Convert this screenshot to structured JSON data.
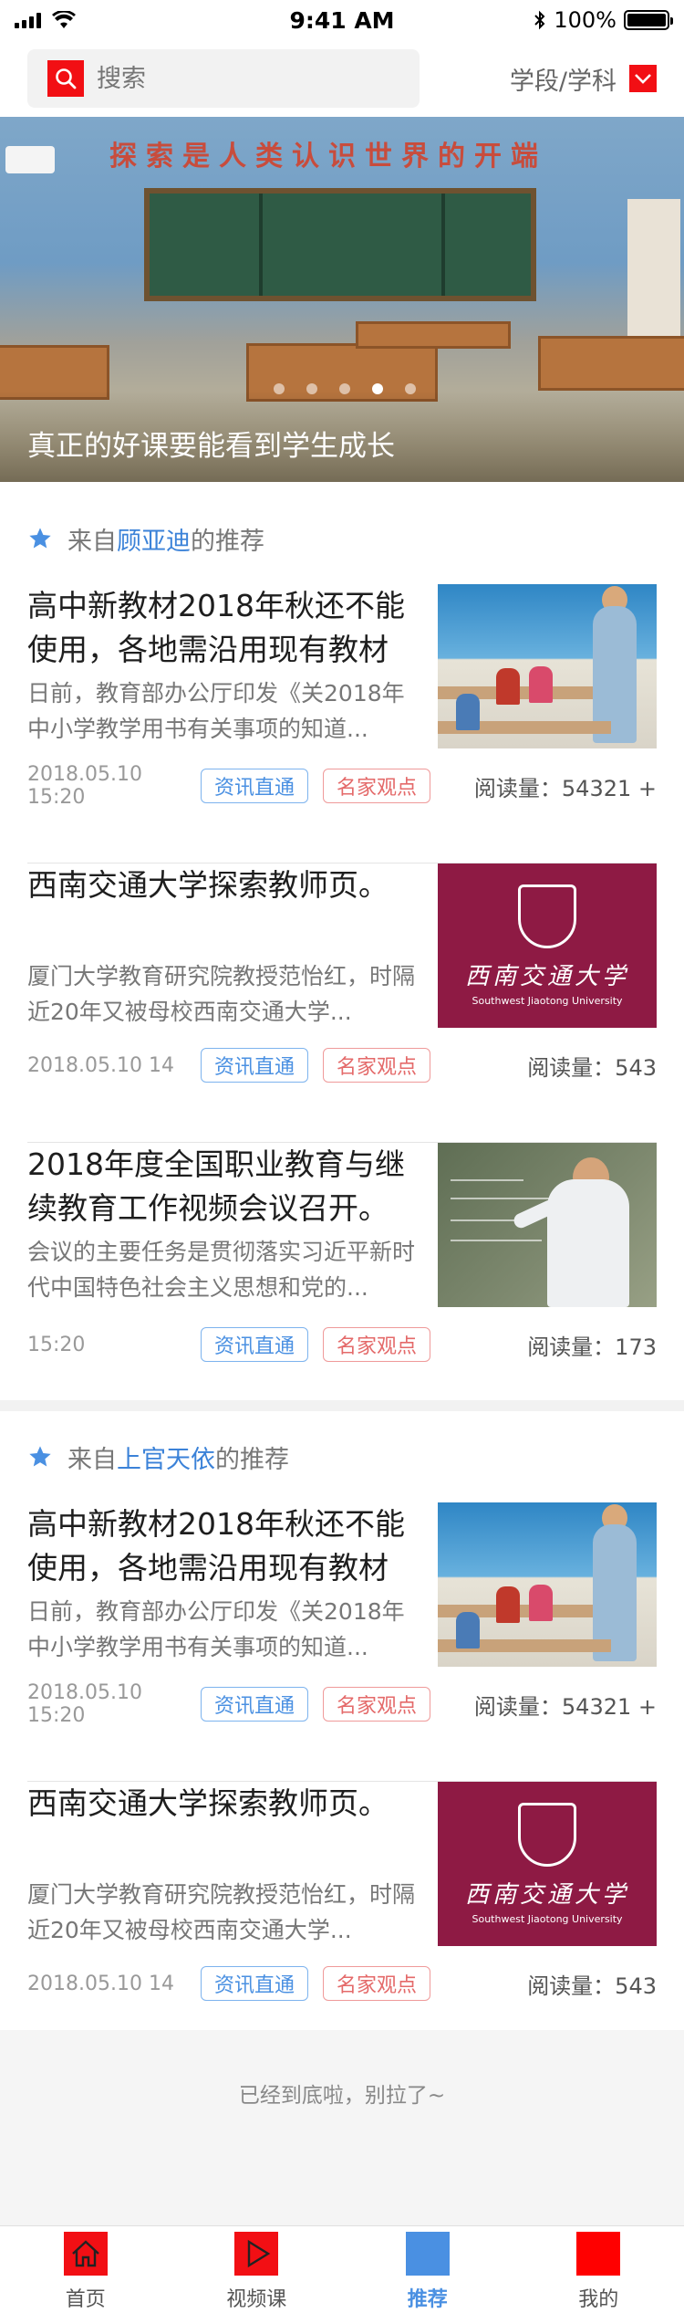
{
  "status_bar": {
    "time": "9:41 AM",
    "battery": "100%",
    "battery_level": 1.0
  },
  "search": {
    "placeholder": "搜索",
    "filter_label": "学段/学科"
  },
  "banner": {
    "wall_text": "探索是人类认识世界的开端",
    "caption": "真正的好课要能看到学生成长",
    "active_dot": 4,
    "dot_count": 5
  },
  "sections": [
    {
      "prefix": "来自",
      "recommender": "顾亚迪",
      "suffix": "的推荐",
      "articles": [
        {
          "title": "高中新教材2018年秋还不能使用，各地需沿用现有教材",
          "summary": "日前，教育部办公厅印发《关2018年中小学教学用书有关事项的知道...",
          "date": "2018.05.10 15:20",
          "tags": [
            "资讯直通",
            "名家观点"
          ],
          "reads": "阅读量：54321 +",
          "thumb": "classroom"
        },
        {
          "title": "西南交通大学探索教师页。",
          "summary": "厦门大学教育研究院教授范怡红，时隔近20年又被母校西南交通大学...",
          "date": "2018.05.10 14",
          "tags": [
            "资讯直通",
            "名家观点"
          ],
          "reads": "阅读量：543",
          "thumb": "swjtu"
        },
        {
          "title": "2018年度全国职业教育与继续教育工作视频会议召开。",
          "summary": "会议的主要任务是贯彻落实习近平新时代中国特色社会主义思想和党的...",
          "date": "15:20",
          "tags": [
            "资讯直通",
            "名家观点"
          ],
          "reads": "阅读量：173",
          "thumb": "chalkboard"
        }
      ]
    },
    {
      "prefix": "来自",
      "recommender": "上官天依",
      "suffix": "的推荐",
      "articles": [
        {
          "title": "高中新教材2018年秋还不能使用，各地需沿用现有教材",
          "summary": "日前，教育部办公厅印发《关2018年中小学教学用书有关事项的知道...",
          "date": "2018.05.10 15:20",
          "tags": [
            "资讯直通",
            "名家观点"
          ],
          "reads": "阅读量：54321 +",
          "thumb": "classroom"
        },
        {
          "title": "西南交通大学探索教师页。",
          "summary": "厦门大学教育研究院教授范怡红，时隔近20年又被母校西南交通大学...",
          "date": "2018.05.10 14",
          "tags": [
            "资讯直通",
            "名家观点"
          ],
          "reads": "阅读量：543",
          "thumb": "swjtu"
        }
      ]
    }
  ],
  "thumb_text": {
    "swjtu_cn": "西南交通大学",
    "swjtu_en": "Southwest Jiaotong University"
  },
  "end_text": "已经到底啦，别拉了~",
  "tabs": [
    {
      "label": "首页",
      "icon": "home-icon"
    },
    {
      "label": "视频课",
      "icon": "play-icon"
    },
    {
      "label": "推荐",
      "icon": "recommend-icon"
    },
    {
      "label": "我的",
      "icon": "profile-icon"
    }
  ],
  "active_tab": 2,
  "colors": {
    "accent_red": "#f20f14",
    "accent_blue": "#4a90e2",
    "tag_red": "#e46a6a",
    "swjtu_maroon": "#8e1a44"
  }
}
